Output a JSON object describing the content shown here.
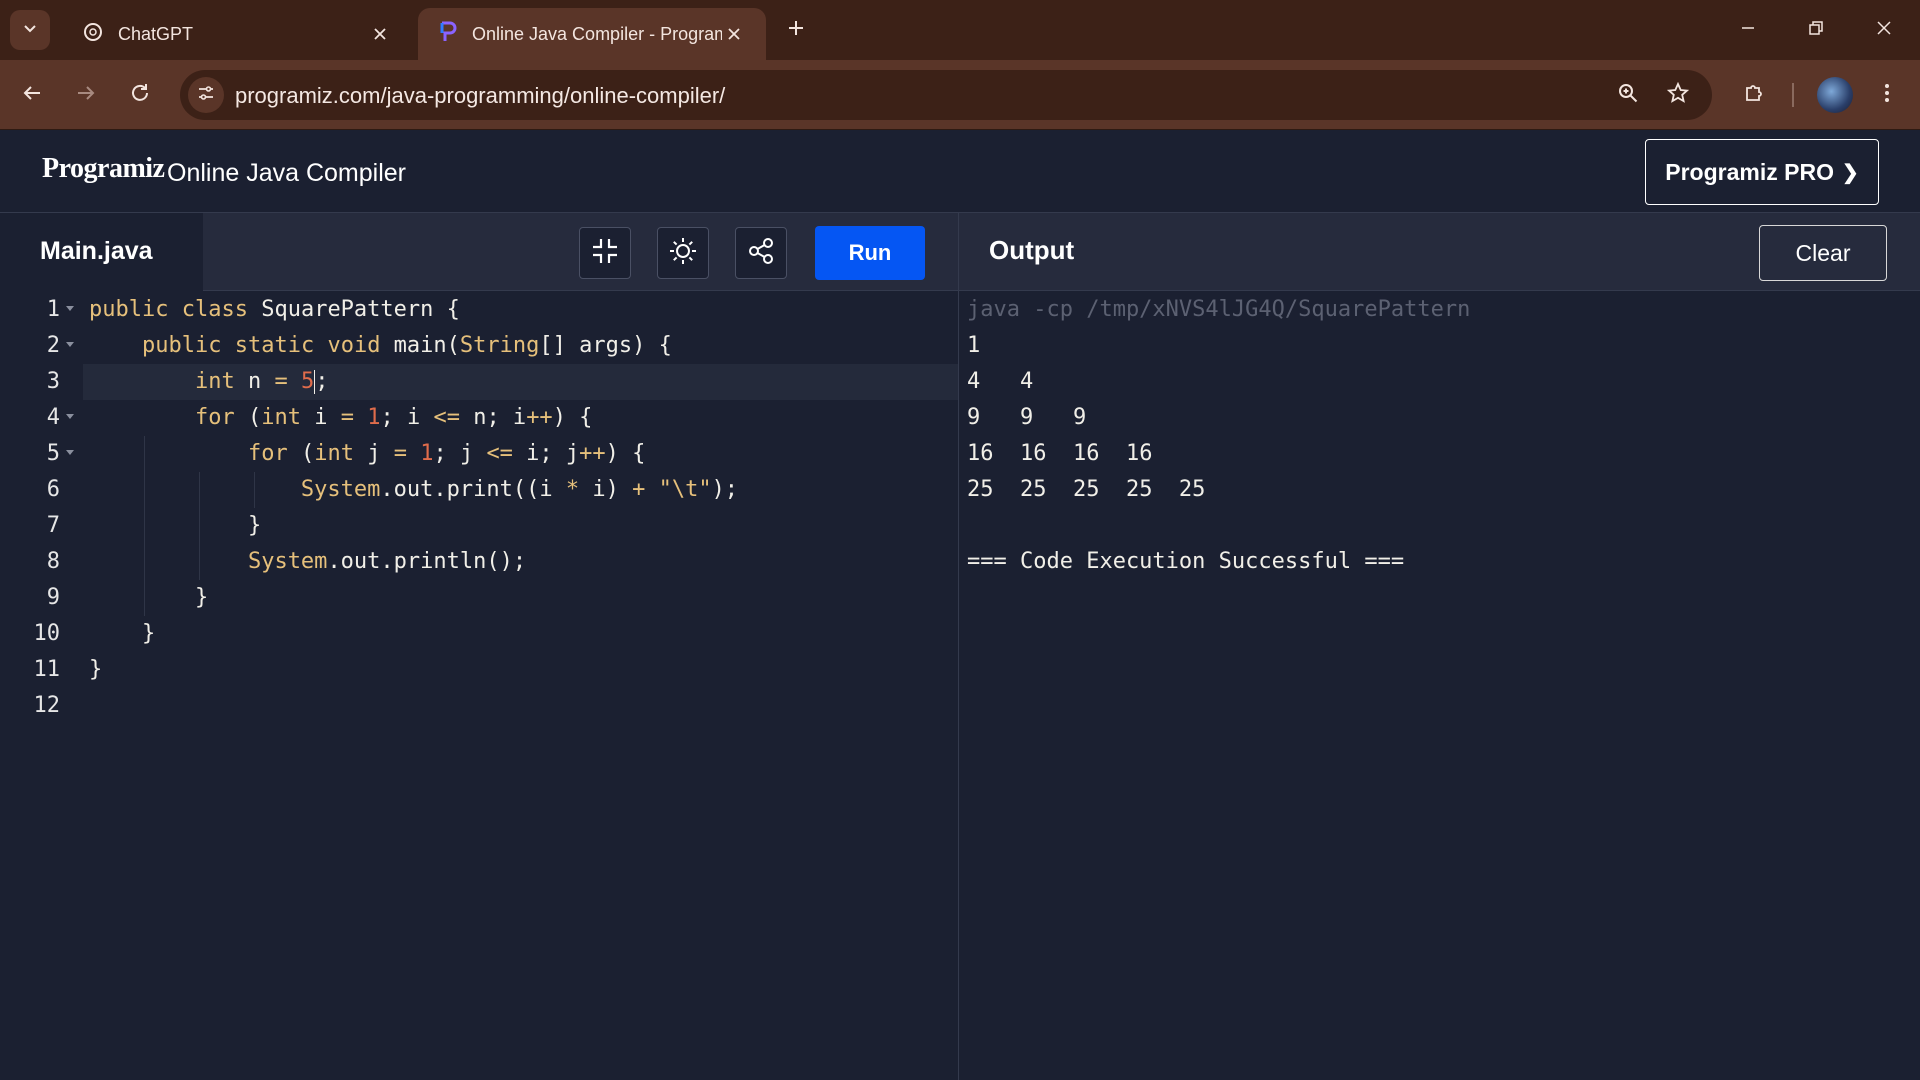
{
  "browser": {
    "tabs": [
      {
        "title": "ChatGPT",
        "icon": "openai-icon",
        "active": false
      },
      {
        "title": "Online Java Compiler - Programiz",
        "icon": "programiz-icon",
        "active": true
      }
    ],
    "url": "programiz.com/java-programming/online-compiler/"
  },
  "header": {
    "logo": "Programiz",
    "title": "Online Java Compiler",
    "pro_label": "Programiz PRO",
    "pro_chevron": "❯"
  },
  "editor": {
    "filename": "Main.java",
    "run_label": "Run",
    "line_numbers": [
      "1",
      "2",
      "3",
      "4",
      "5",
      "6",
      "7",
      "8",
      "9",
      "10",
      "11",
      "12"
    ]
  },
  "output": {
    "title": "Output",
    "clear_label": "Clear",
    "lines": [
      "java -cp /tmp/xNVS4lJG4Q/SquarePattern",
      "1\t",
      "4\t4\t",
      "9\t9\t9\t",
      "16\t16\t16\t16\t",
      "25\t25\t25\t25\t25\t",
      "",
      "=== Code Execution Successful ==="
    ]
  },
  "colors": {
    "accent_run": "#0556f3",
    "bg": "#1b2031",
    "keyword": "#e6c07b",
    "number": "#e06c4b"
  }
}
